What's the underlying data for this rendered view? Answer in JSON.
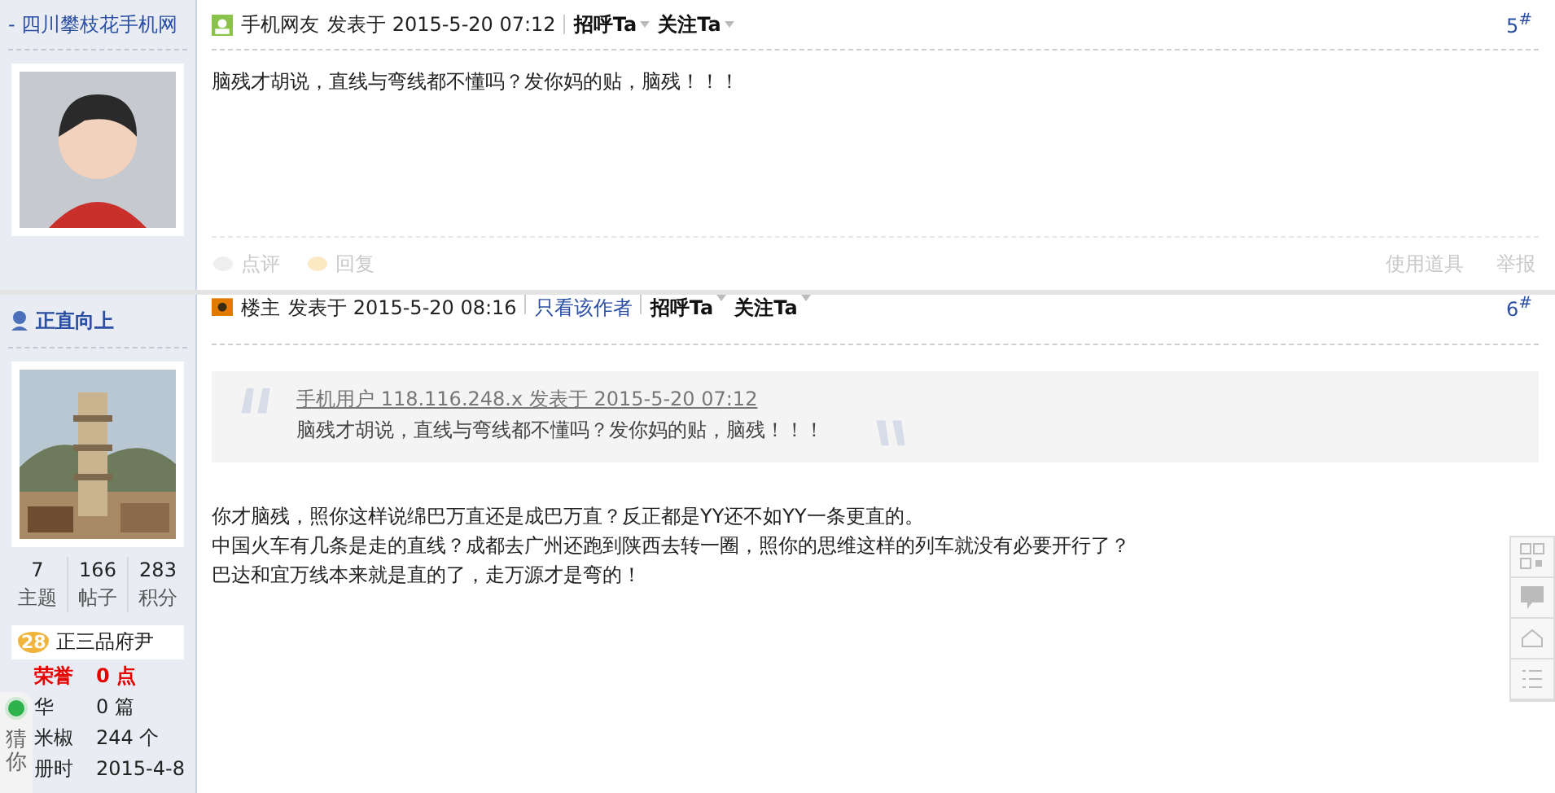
{
  "posts": [
    {
      "author": {
        "name": "- 四川攀枝花手机网",
        "kind": "avatar"
      },
      "header": {
        "poster": "手机网友",
        "posted": "发表于 2015-5-20 07:12",
        "actions": [
          "招呼Ta",
          "关注Ta"
        ],
        "floor": "5$^{#}$"
      },
      "body": [
        "脑残才胡说，直线与弯线都不懂吗？发你妈的贴，脑残！！！"
      ],
      "footer": {
        "left": [
          "点评",
          "回复"
        ],
        "right": [
          "使用道具",
          "举报"
        ]
      }
    },
    {
      "author": {
        "name": "正直向上",
        "kind": "picture",
        "stats": [
          {
            "value": "7",
            "label": "主题"
          },
          {
            "value": "166",
            "label": "帖子"
          },
          {
            "value": "283",
            "label": "积分"
          }
        ],
        "rank": {
          "level": "28",
          "title": "正三品府尹"
        },
        "details": [
          {
            "label": "荣誉",
            "value": "0 点",
            "kind": "highlight"
          },
          {
            "label": "华",
            "value": "0 篇",
            "kind": "plain"
          },
          {
            "label": "米椒",
            "value": "244 个",
            "kind": "plain"
          },
          {
            "label": "册时",
            "value": "2015-4-8",
            "kind": "plain"
          }
        ]
      },
      "header": {
        "poster": "楼主",
        "posted": "发表于 2015-5-20 08:16",
        "link": "只看该作者",
        "actions": [
          "招呼Ta",
          "关注Ta"
        ],
        "floor": "6$^{#}$"
      },
      "quote": {
        "source": "手机用户 118.116.248.x 发表于 2015-5-20 07:12",
        "text": "脑残才胡说，直线与弯线都不懂吗？发你妈的贴，脑残！！！"
      },
      "body": [
        "你才脑残，照你这样说绵巴万直还是成巴万直？反正都是YY还不如YY一条更直的。",
        "中国火车有几条是走的直线？成都去广州还跑到陕西去转一圈，照你的思维这样的列车就没有必要开行了？",
        "巴达和宜万线本来就是直的了，走万源才是弯的！"
      ]
    }
  ],
  "floating_widget": {
    "text": "猜你"
  }
}
